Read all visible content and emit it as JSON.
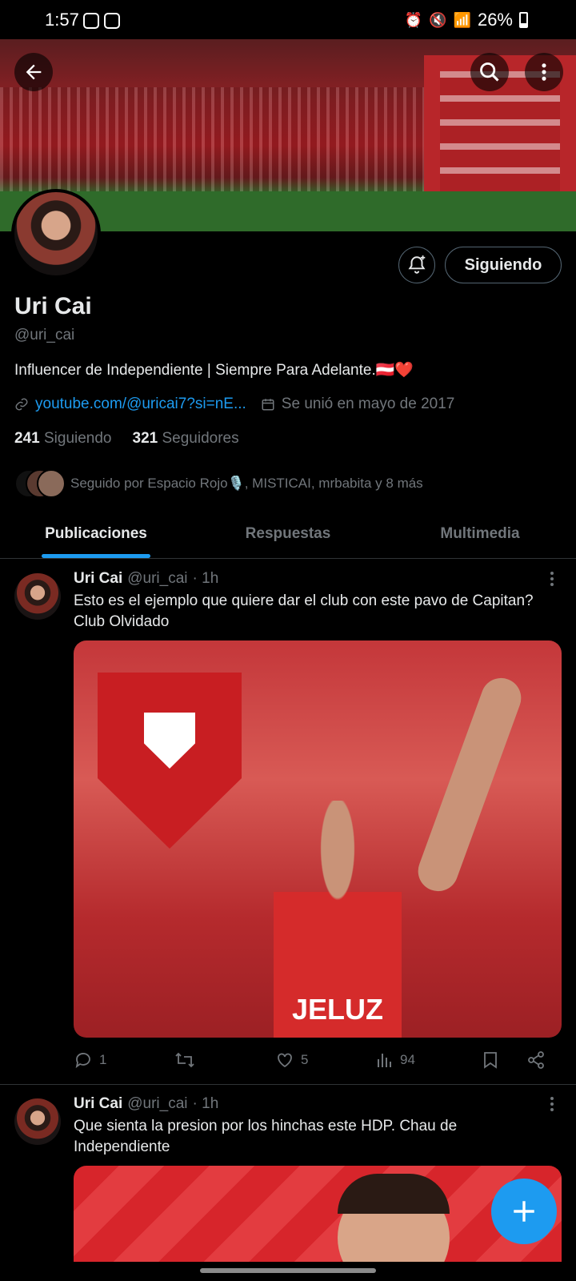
{
  "status_bar": {
    "time": "1:57",
    "battery": "26%"
  },
  "profile": {
    "name": "Uri Cai",
    "handle": "@uri_cai",
    "bio": "Influencer de Independiente | Siempre Para Adelante.🇦🇹❤️",
    "link": "youtube.com/@uricai7?si=nE...",
    "joined": "Se unió en mayo de 2017",
    "following_count": "241",
    "following_label": "Siguiendo",
    "followers_count": "321",
    "followers_label": "Seguidores",
    "followed_by": "Seguido por Espacio Rojo🎙️, MISTICAI, mrbabita y 8 más",
    "follow_button": "Siguiendo"
  },
  "tabs": [
    "Publicaciones",
    "Respuestas",
    "Multimedia"
  ],
  "posts": [
    {
      "name": "Uri Cai",
      "handle": "@uri_cai",
      "time": "· 1h",
      "text_line1": "Esto es el ejemplo que quiere dar el club con este pavo de Capitan?",
      "text_line2": "Club Olvidado",
      "media_text": "JELUZ",
      "replies": "1",
      "likes": "5",
      "views": "94"
    },
    {
      "name": "Uri Cai",
      "handle": "@uri_cai",
      "time": "· 1h",
      "text_line1": "Que sienta la presion por los hinchas este HDP. Chau de",
      "text_line2": "Independiente"
    }
  ],
  "colors": {
    "accent": "#1d9bf0",
    "background": "#000000",
    "secondary_text": "#71767b"
  }
}
